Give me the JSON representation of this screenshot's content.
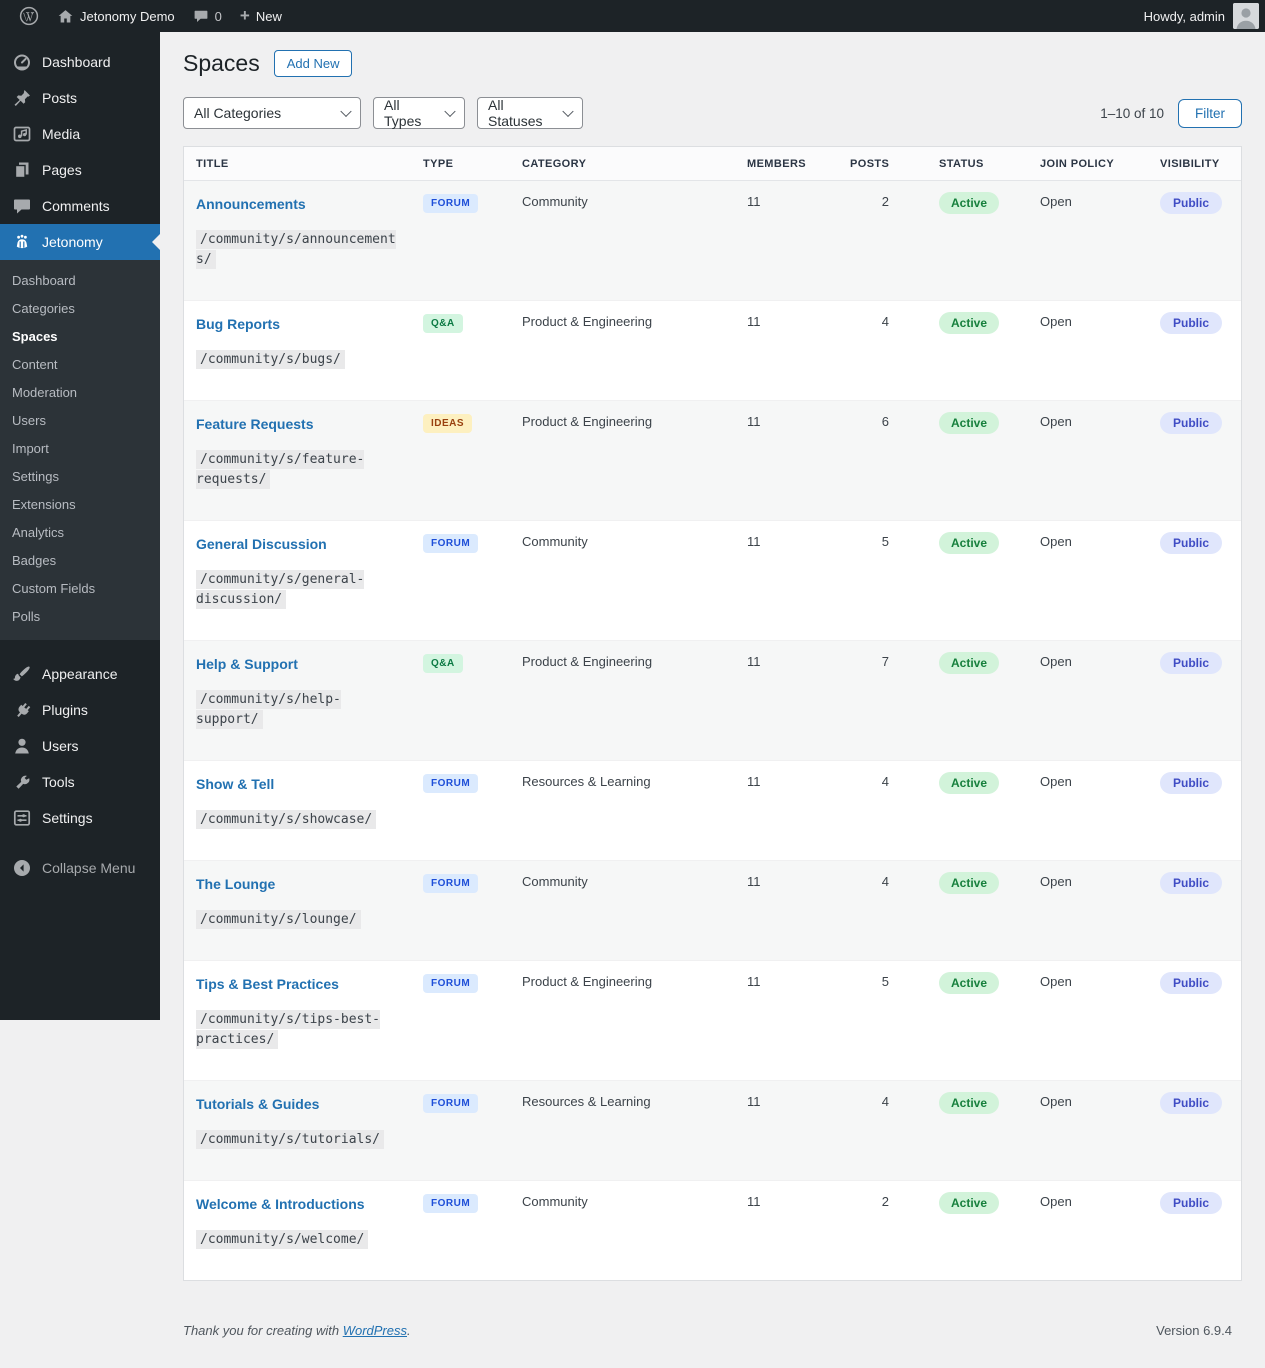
{
  "admin_bar": {
    "site_name": "Jetonomy Demo",
    "comments_count": "0",
    "new_label": "New",
    "howdy": "Howdy, admin"
  },
  "sidebar": {
    "menu": [
      {
        "label": "Dashboard",
        "icon": "dashboard-gauge-icon"
      },
      {
        "label": "Posts",
        "icon": "pushpin-icon"
      },
      {
        "label": "Media",
        "icon": "media-icon"
      },
      {
        "label": "Pages",
        "icon": "pages-icon"
      },
      {
        "label": "Comments",
        "icon": "comment-bubble-icon"
      },
      {
        "label": "Jetonomy",
        "icon": "groups-icon"
      }
    ],
    "submenu": [
      "Dashboard",
      "Categories",
      "Spaces",
      "Content",
      "Moderation",
      "Users",
      "Import",
      "Settings",
      "Extensions",
      "Analytics",
      "Badges",
      "Custom Fields",
      "Polls"
    ],
    "current_submenu": "Spaces",
    "lower_menu": [
      {
        "label": "Appearance",
        "icon": "paintbrush-icon"
      },
      {
        "label": "Plugins",
        "icon": "plug-icon"
      },
      {
        "label": "Users",
        "icon": "user-icon"
      },
      {
        "label": "Tools",
        "icon": "wrench-icon"
      },
      {
        "label": "Settings",
        "icon": "sliders-icon"
      }
    ],
    "collapse_label": "Collapse Menu"
  },
  "page": {
    "title": "Spaces",
    "add_new_label": "Add New",
    "filters": {
      "categories": "All Categories",
      "types": "All Types",
      "statuses": "All Statuses"
    },
    "count_text": "1–10 of 10",
    "filter_button_label": "Filter"
  },
  "table": {
    "columns": [
      "Title",
      "Type",
      "Category",
      "Members",
      "Posts",
      "Status",
      "Join Policy",
      "Visibility"
    ],
    "rows": [
      {
        "title": "Announcements",
        "slug": "/community/s/announcements/",
        "type": "Forum",
        "type_kind": "forum",
        "category": "Community",
        "members": "11",
        "posts": "2",
        "status": "Active",
        "join_policy": "Open",
        "visibility": "Public"
      },
      {
        "title": "Bug Reports",
        "slug": "/community/s/bugs/",
        "type": "Q&A",
        "type_kind": "qa",
        "category": "Product & Engineering",
        "members": "11",
        "posts": "4",
        "status": "Active",
        "join_policy": "Open",
        "visibility": "Public"
      },
      {
        "title": "Feature Requests",
        "slug": "/community/s/feature-requests/",
        "type": "Ideas",
        "type_kind": "ideas",
        "category": "Product & Engineering",
        "members": "11",
        "posts": "6",
        "status": "Active",
        "join_policy": "Open",
        "visibility": "Public"
      },
      {
        "title": "General Discussion",
        "slug": "/community/s/general-discussion/",
        "type": "Forum",
        "type_kind": "forum",
        "category": "Community",
        "members": "11",
        "posts": "5",
        "status": "Active",
        "join_policy": "Open",
        "visibility": "Public"
      },
      {
        "title": "Help & Support",
        "slug": "/community/s/help-support/",
        "type": "Q&A",
        "type_kind": "qa",
        "category": "Product & Engineering",
        "members": "11",
        "posts": "7",
        "status": "Active",
        "join_policy": "Open",
        "visibility": "Public"
      },
      {
        "title": "Show & Tell",
        "slug": "/community/s/showcase/",
        "type": "Forum",
        "type_kind": "forum",
        "category": "Resources & Learning",
        "members": "11",
        "posts": "4",
        "status": "Active",
        "join_policy": "Open",
        "visibility": "Public"
      },
      {
        "title": "The Lounge",
        "slug": "/community/s/lounge/",
        "type": "Forum",
        "type_kind": "forum",
        "category": "Community",
        "members": "11",
        "posts": "4",
        "status": "Active",
        "join_policy": "Open",
        "visibility": "Public"
      },
      {
        "title": "Tips & Best Practices",
        "slug": "/community/s/tips-best-practices/",
        "type": "Forum",
        "type_kind": "forum",
        "category": "Product & Engineering",
        "members": "11",
        "posts": "5",
        "status": "Active",
        "join_policy": "Open",
        "visibility": "Public"
      },
      {
        "title": "Tutorials & Guides",
        "slug": "/community/s/tutorials/",
        "type": "Forum",
        "type_kind": "forum",
        "category": "Resources & Learning",
        "members": "11",
        "posts": "4",
        "status": "Active",
        "join_policy": "Open",
        "visibility": "Public"
      },
      {
        "title": "Welcome & Introductions",
        "slug": "/community/s/welcome/",
        "type": "Forum",
        "type_kind": "forum",
        "category": "Community",
        "members": "11",
        "posts": "2",
        "status": "Active",
        "join_policy": "Open",
        "visibility": "Public"
      }
    ]
  },
  "footer": {
    "thanks_prefix": "Thank you for creating with ",
    "wordpress_link": "WordPress",
    "thanks_suffix": ".",
    "version": "Version 6.9.4"
  },
  "colors": {
    "admin_dark": "#1d2327",
    "submenu_dark": "#2c3338",
    "accent_blue": "#2271b1",
    "page_background": "#f0f0f1",
    "badge_forum_bg": "#dbeafe",
    "badge_forum_text": "#1d4ed8",
    "badge_qa_bg": "#d3f5e0",
    "badge_qa_text": "#0b7a43",
    "badge_ideas_bg": "#fdf0c0",
    "badge_ideas_text": "#98400f",
    "status_active_bg": "#d2f3da",
    "status_active_text": "#17803d",
    "visibility_public_bg": "#e0e6fc",
    "visibility_public_text": "#3f4cc4"
  }
}
